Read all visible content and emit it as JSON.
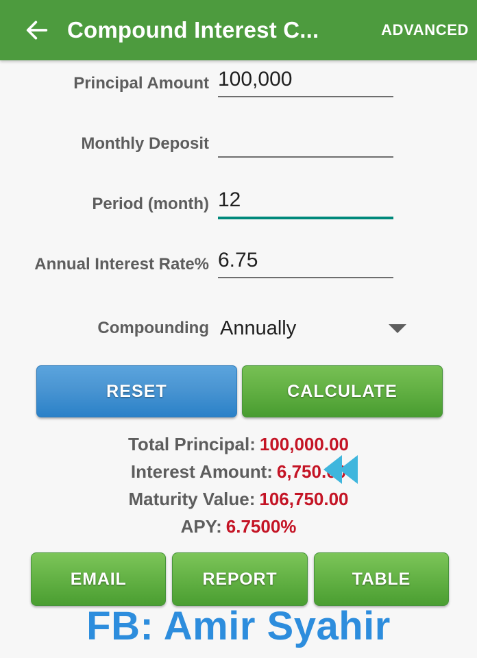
{
  "appbar": {
    "back_icon": "arrow-left-icon",
    "title": "Compound Interest C...",
    "action_label": "ADVANCED",
    "background_color": "#4d9b3e"
  },
  "form": {
    "fields": [
      {
        "label": "Principal Amount",
        "value": "100,000",
        "placeholder": "",
        "focused": false
      },
      {
        "label": "Monthly Deposit",
        "value": "",
        "placeholder": "",
        "focused": false
      },
      {
        "label": "Period (month)",
        "value": "12",
        "placeholder": "",
        "focused": true
      },
      {
        "label": "Annual Interest Rate%",
        "value": "6.75",
        "placeholder": "",
        "focused": false
      }
    ],
    "compounding": {
      "label": "Compounding",
      "value": "Annually",
      "dropdown_icon": "chevron-down-icon"
    }
  },
  "actions": {
    "reset_label": "RESET",
    "calculate_label": "CALCULATE",
    "reset_color": "#3a8fd0",
    "calculate_color": "#57a93a"
  },
  "results": {
    "value_color": "#c41425",
    "label_color": "#5d5d5d",
    "rows": [
      {
        "label": "Total Principal:",
        "value": "100,000.00"
      },
      {
        "label": "Interest Amount:",
        "value": "6,750.00"
      },
      {
        "label": "Maturity Value:",
        "value": "106,750.00"
      },
      {
        "label": "APY:",
        "value": "6.7500%"
      }
    ],
    "annotation": {
      "icon": "double-arrow-left-icon",
      "color": "#3fb6dd",
      "points_at": "Interest Amount:"
    }
  },
  "bottom_actions": [
    {
      "label": "EMAIL"
    },
    {
      "label": "REPORT"
    },
    {
      "label": "TABLE"
    }
  ],
  "watermark": {
    "text": "FB: Amir Syahir",
    "color": "#2d8ddd"
  }
}
